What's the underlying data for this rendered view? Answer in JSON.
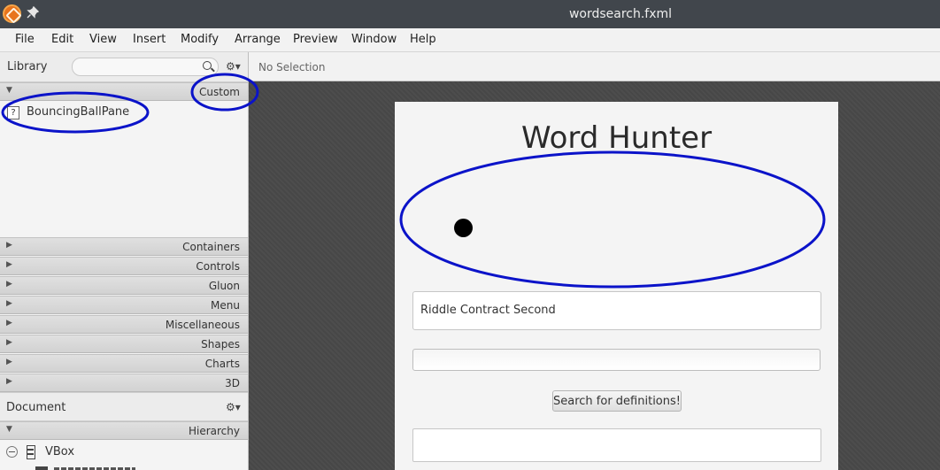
{
  "window": {
    "title": "wordsearch.fxml"
  },
  "menu": [
    "File",
    "Edit",
    "View",
    "Insert",
    "Modify",
    "Arrange",
    "Preview",
    "Window",
    "Help"
  ],
  "library": {
    "label": "Library",
    "search_value": "",
    "custom_section": "Custom",
    "custom_items": [
      "BouncingBallPane"
    ],
    "sections": [
      "Containers",
      "Controls",
      "Gluon",
      "Menu",
      "Miscellaneous",
      "Shapes",
      "Charts",
      "3D"
    ]
  },
  "document": {
    "label": "Document",
    "section": "Hierarchy",
    "tree": [
      {
        "label": "VBox"
      }
    ]
  },
  "editor": {
    "selection": "No Selection",
    "app_title": "Word Hunter",
    "text_area_value": "Riddle Contract Second",
    "input_value": "",
    "button_label": "Search for definitions!"
  },
  "colors": {
    "annotation": "#0b13c9",
    "titlebar": "#41464c",
    "canvas": "#474747"
  },
  "icons": [
    "scene-builder-logo-icon",
    "pin-icon",
    "search-icon",
    "gear-icon",
    "unknown-component-icon",
    "collapse-icon",
    "vbox-icon"
  ]
}
